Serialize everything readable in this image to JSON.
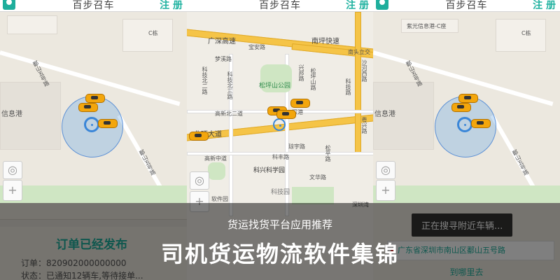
{
  "header": {
    "app_title": "百步召车",
    "register_label": "注 册"
  },
  "panel1": {
    "road_labels": [
      "鄱山五号路",
      "鄱山五号路"
    ],
    "place_labels": [
      "信息港",
      "C栋"
    ],
    "order": {
      "title": "订单已经发布",
      "order_no": "订单：820902000000000",
      "status": "状态：已通知12辆车,等待接单..."
    }
  },
  "panel2": {
    "road_labels": [
      "广深高速",
      "南坪快速",
      "北环大道",
      "宝安路",
      "梦溪路",
      "南头立交",
      "琼宇路",
      "科丰路",
      "文华路",
      "高新北二道",
      "高新中道",
      "科技北二路",
      "科技北三路",
      "松坪山路",
      "沙河西路",
      "兴邦路",
      "科技路",
      "粤兴路",
      "松平路"
    ],
    "place_labels": [
      "松坪山公园",
      "科兴科学园",
      "科技园",
      "软件园",
      "深港",
      "深圳湾"
    ]
  },
  "panel3": {
    "road_labels": [
      "鄱山五号路",
      "鄱山五号路"
    ],
    "place_labels": [
      "紫光信息港-C座",
      "信息港",
      "C栋"
    ],
    "toast": "正在搜寻附近车辆...",
    "address": "广东省深圳市南山区鄱山五号路",
    "destination": "到哪里去"
  },
  "overlay": {
    "subtitle": "货运找货平台应用推荐",
    "title": "司机货运物流软件集锦"
  },
  "colors": {
    "brand": "#1fae9c",
    "road": "#f5c447",
    "car": "#f3a60c",
    "location": "#3a86d8"
  },
  "icons": [
    "user-avatar-icon",
    "locate-icon",
    "zoom-in-icon",
    "zoom-out-icon",
    "car-icon",
    "location-target-icon"
  ]
}
